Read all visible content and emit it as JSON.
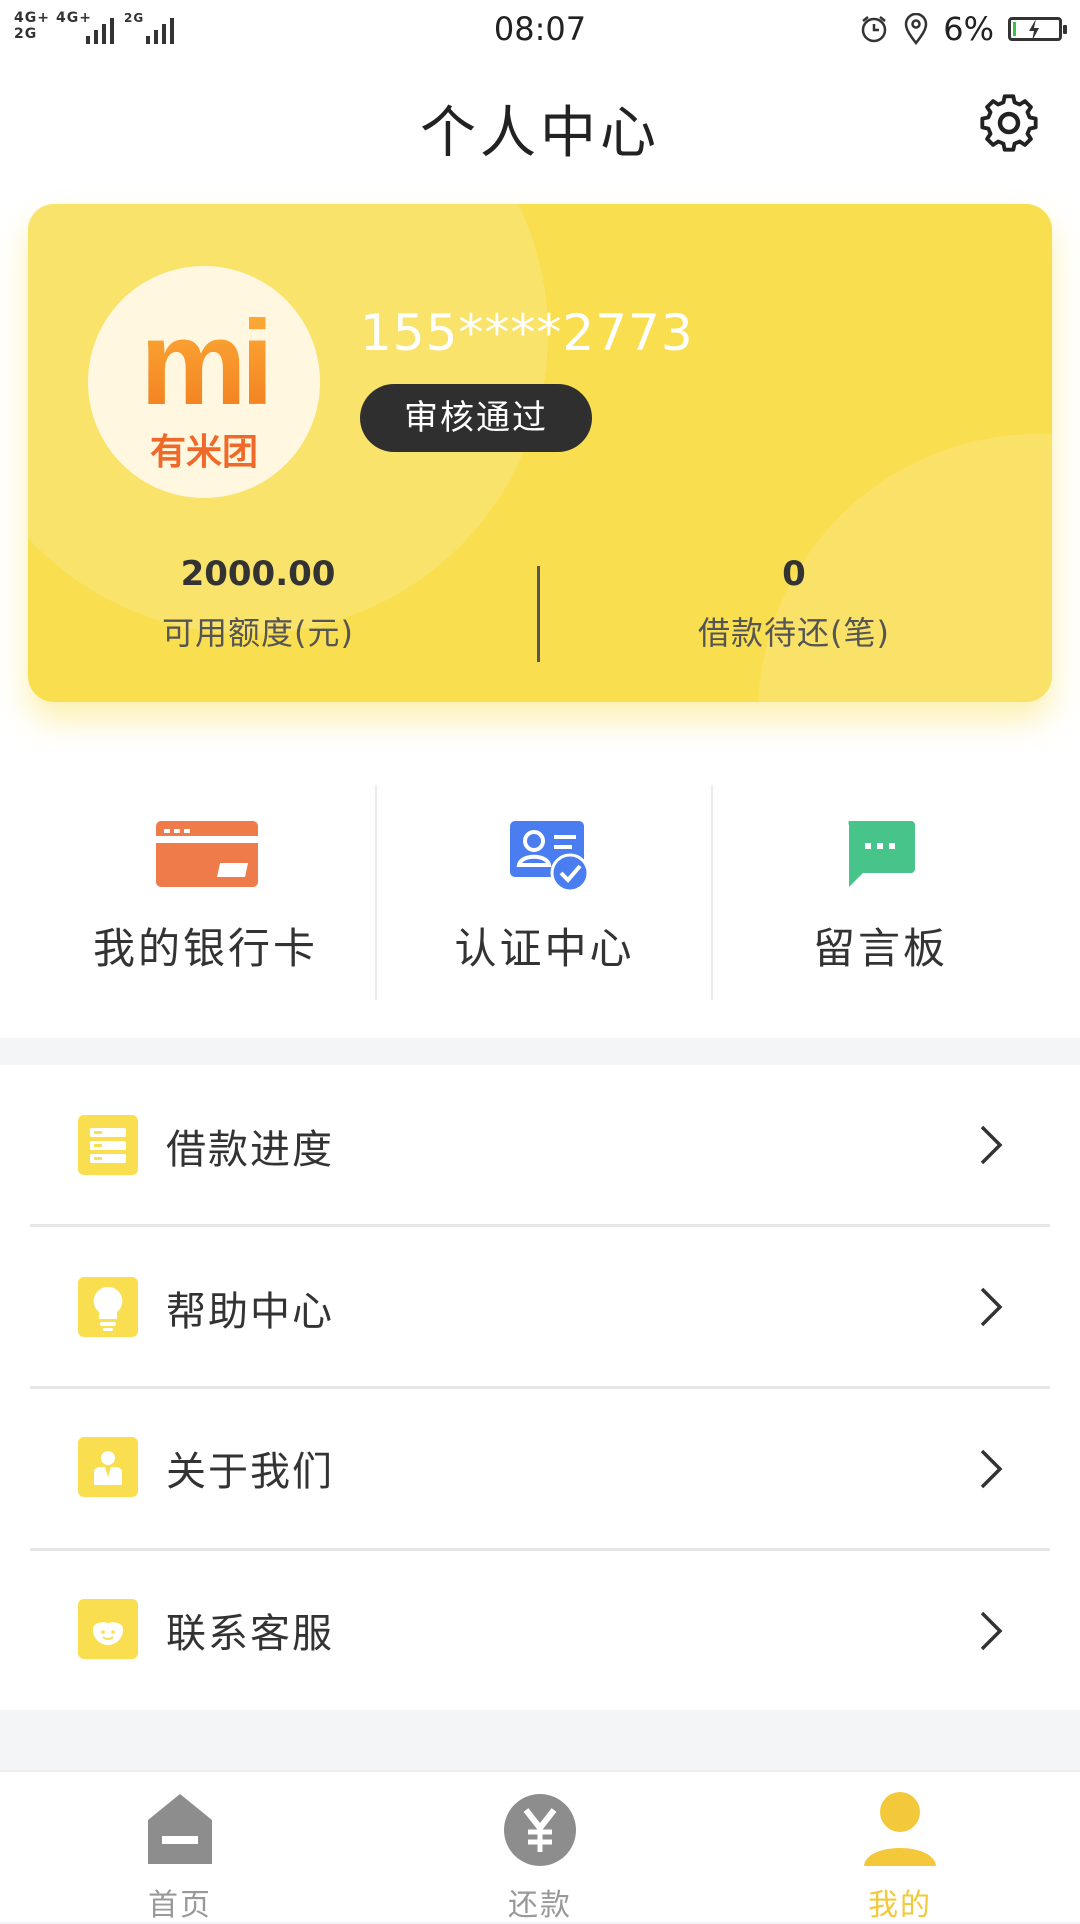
{
  "status_bar": {
    "network_1": "4G+",
    "network_2": "4G+",
    "network_3": "2G",
    "network_4": "2G",
    "time": "08:07",
    "battery_percent": "6%",
    "battery_level": 0.06
  },
  "header": {
    "title": "个人中心",
    "settings_icon": "gear-icon"
  },
  "profile": {
    "avatar_logo_text": "mi",
    "avatar_logo_caption": "有米团",
    "phone": "155****2773",
    "status_badge": "审核通过",
    "stats": [
      {
        "value": "2000.00",
        "label": "可用额度(元)"
      },
      {
        "value": "0",
        "label": "借款待还(笔)"
      }
    ]
  },
  "shortcuts": [
    {
      "label": "我的银行卡",
      "icon": "bank-card-icon",
      "color": "#ef7a4a"
    },
    {
      "label": "认证中心",
      "icon": "verified-id-icon",
      "color": "#4a7df0"
    },
    {
      "label": "留言板",
      "icon": "message-board-icon",
      "color": "#46c48a"
    }
  ],
  "menu": [
    {
      "label": "借款进度",
      "icon": "progress-list-icon"
    },
    {
      "label": "帮助中心",
      "icon": "lightbulb-icon"
    },
    {
      "label": "关于我们",
      "icon": "person-badge-icon"
    },
    {
      "label": "联系客服",
      "icon": "customer-service-icon"
    }
  ],
  "tabbar": {
    "items": [
      {
        "label": "首页",
        "icon": "home-icon",
        "active": false
      },
      {
        "label": "还款",
        "icon": "yen-icon",
        "active": false
      },
      {
        "label": "我的",
        "icon": "user-icon",
        "active": true
      }
    ]
  },
  "colors": {
    "accent": "#f9de4f",
    "tab_active": "#f3c83a",
    "badge_bg": "#2f2f2f"
  }
}
